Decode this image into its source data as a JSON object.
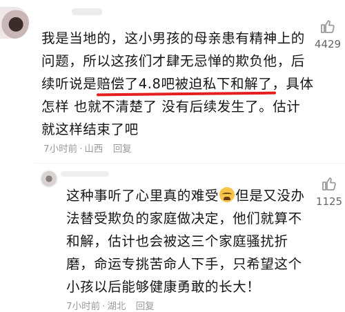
{
  "comment1": {
    "lines": {
      "l1": "我是当地的，这小男孩的母亲患有精神上的",
      "l2": "问题，所以这孩们才肆无忌惮的欺负他，后",
      "l3_pre": "续听说是",
      "l3_underlined": "赔偿了4.8吧被迫私下和解了",
      "l3_post": "，具体",
      "l4": "怎样 也就不清楚了 没有后续发生了。估计",
      "l5": "就这样结束了吧"
    },
    "time": "7小时前",
    "location": "山西",
    "reply_label": "回复",
    "like_count": "4429"
  },
  "comment2": {
    "lines": {
      "l1_pre": "这种事听了心里真的难受",
      "l1_post": "但是又没办",
      "l2": "法替受欺负的家庭做决定，他们就算不",
      "l3": "和解，估计也会被这三个家庭骚扰折",
      "l4": "磨，命运专挑苦命人下手，只希望这个",
      "l5": "小孩以后能够健康勇敢的长大！"
    },
    "time": "7小时前",
    "location": "湖北",
    "reply_label": "回复",
    "like_count": "1125"
  },
  "colors": {
    "underline": "#e31f1f",
    "meta": "#9a9a9a"
  },
  "icons": {
    "like": "thumbs-up-icon",
    "emoji": "crying-face-emoji"
  }
}
